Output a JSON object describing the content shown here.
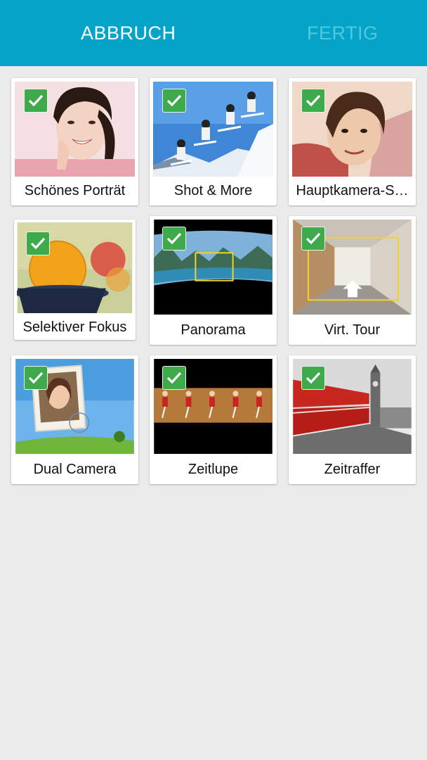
{
  "header": {
    "cancel_label": "ABBRUCH",
    "done_label": "FERTIG"
  },
  "colors": {
    "topbar": "#05a3c8",
    "done_disabled": "#4fc9df",
    "check_green": "#3faa4c",
    "background": "#ebebeb"
  },
  "modes": [
    {
      "label": "Schönes Porträt",
      "checked": true,
      "icon": "beauty-portrait-thumbnail"
    },
    {
      "label": "Shot & More",
      "checked": true,
      "icon": "shot-and-more-thumbnail"
    },
    {
      "label": "Hauptkamera-S…",
      "checked": true,
      "icon": "selfie-thumbnail"
    },
    {
      "label": "Selektiver Fokus",
      "checked": true,
      "icon": "selective-focus-thumbnail"
    },
    {
      "label": "Panorama",
      "checked": true,
      "icon": "panorama-thumbnail"
    },
    {
      "label": "Virt. Tour",
      "checked": true,
      "icon": "virtual-tour-thumbnail"
    },
    {
      "label": "Dual Camera",
      "checked": true,
      "icon": "dual-camera-thumbnail"
    },
    {
      "label": "Zeitlupe",
      "checked": true,
      "icon": "slow-motion-thumbnail"
    },
    {
      "label": "Zeitraffer",
      "checked": true,
      "icon": "hyperlapse-thumbnail"
    }
  ]
}
